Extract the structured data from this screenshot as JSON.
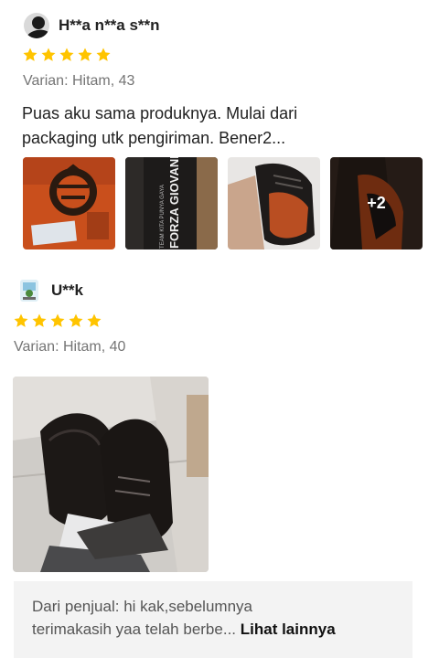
{
  "reviews": [
    {
      "username": "H**a n**a s**n",
      "stars": 5,
      "variant": "Varian: Hitam, 43",
      "text_line1": "Puas aku sama produknya. Mulai dari",
      "text_line2": "packaging utk pengiriman. Bener2...",
      "photos": [
        {
          "desc": "shoe box with logo"
        },
        {
          "desc": "FORZA GIOVANE box",
          "box_text": "FORZA GIOVANE",
          "box_subtext": "TEAM KITA PUNYA GAYA"
        },
        {
          "desc": "shoe held in hand"
        },
        {
          "desc": "shoe interior",
          "more_count": "+2"
        }
      ]
    },
    {
      "username": "U**k",
      "stars": 5,
      "variant": "Varian: Hitam, 40"
    }
  ],
  "seller_reply": {
    "label": "Dari penjual:",
    "line1": "hi kak,sebelumnya",
    "line2": "terimakasih yaa telah berbe...",
    "see_more": "Lihat lainnya"
  },
  "colors": {
    "star": "#FFC400",
    "muted_text": "#757575",
    "reply_bg": "#F3F3F3"
  }
}
